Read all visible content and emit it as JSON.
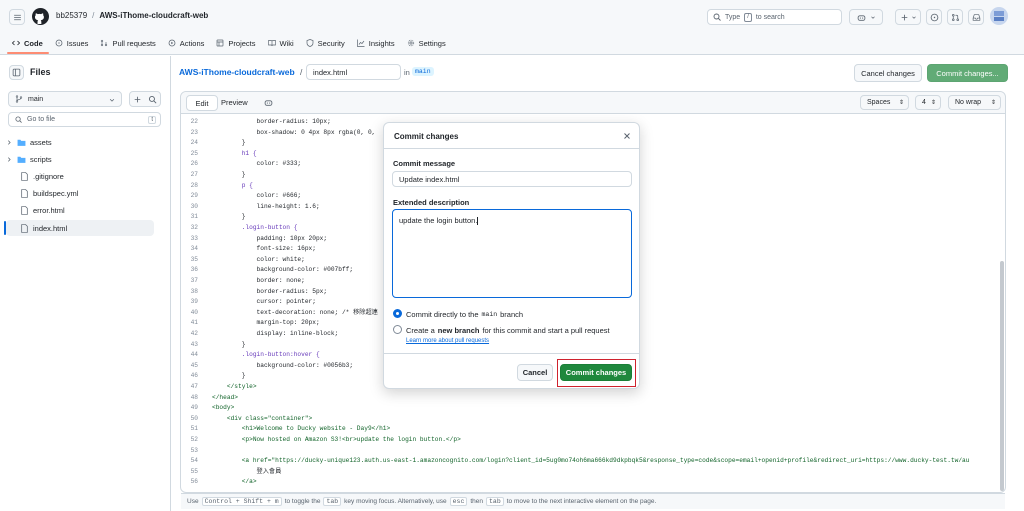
{
  "header": {
    "owner": "bb25379",
    "separator": "/",
    "repo": "AWS-iThome-cloudcraft-web",
    "search_prefix": "Type",
    "search_key": "/",
    "search_suffix": "to search"
  },
  "nav": [
    {
      "label": "Code",
      "icon": "code-icon",
      "active": true
    },
    {
      "label": "Issues",
      "icon": "issue-icon"
    },
    {
      "label": "Pull requests",
      "icon": "pull-request-icon"
    },
    {
      "label": "Actions",
      "icon": "play-icon"
    },
    {
      "label": "Projects",
      "icon": "table-icon"
    },
    {
      "label": "Wiki",
      "icon": "book-icon"
    },
    {
      "label": "Security",
      "icon": "shield-icon"
    },
    {
      "label": "Insights",
      "icon": "graph-icon"
    },
    {
      "label": "Settings",
      "icon": "gear-icon"
    }
  ],
  "sidebar": {
    "title": "Files",
    "branch": "main",
    "goto_placeholder": "Go to file",
    "goto_key": "t",
    "items": [
      {
        "label": "assets",
        "type": "folder"
      },
      {
        "label": "scripts",
        "type": "folder"
      },
      {
        "label": ".gitignore",
        "type": "file"
      },
      {
        "label": "buildspec.yml",
        "type": "file"
      },
      {
        "label": "error.html",
        "type": "file"
      },
      {
        "label": "index.html",
        "type": "file",
        "selected": true
      }
    ]
  },
  "editor": {
    "repo_link": "AWS-iThome-cloudcraft-web",
    "slash": "/",
    "filename": "index.html",
    "in": "in",
    "branch": "main",
    "cancel_label": "Cancel changes",
    "commit_label": "Commit changes...",
    "tab_edit": "Edit",
    "tab_preview": "Preview",
    "indent_mode": "Spaces",
    "indent_size": "4",
    "wrap_mode": "No wrap",
    "footer": {
      "t1": "Use",
      "k1": "Control + Shift + m",
      "t2": "to toggle the",
      "k2": "tab",
      "t3": "key moving focus. Alternatively, use",
      "k3": "esc",
      "t4": "then",
      "k4": "tab",
      "t5": "to move to the next interactive element on the page."
    }
  },
  "code_lines": [
    [
      "22",
      "            border-radius: 10px;"
    ],
    [
      "23",
      "            box-shadow: 0 4px 8px rgba(0, 0,"
    ],
    [
      "24",
      "        }"
    ],
    [
      "25",
      "        h1 {"
    ],
    [
      "26",
      "            color: #333;"
    ],
    [
      "27",
      "        }"
    ],
    [
      "28",
      "        p {"
    ],
    [
      "29",
      "            color: #666;"
    ],
    [
      "30",
      "            line-height: 1.6;"
    ],
    [
      "31",
      "        }"
    ],
    [
      "32",
      "        .login-button {"
    ],
    [
      "33",
      "            padding: 10px 20px;"
    ],
    [
      "34",
      "            font-size: 16px;"
    ],
    [
      "35",
      "            color: white;"
    ],
    [
      "36",
      "            background-color: #007bff;"
    ],
    [
      "37",
      "            border: none;"
    ],
    [
      "38",
      "            border-radius: 5px;"
    ],
    [
      "39",
      "            cursor: pointer;"
    ],
    [
      "40",
      "            text-decoration: none; /* 移除超連"
    ],
    [
      "41",
      "            margin-top: 20px;"
    ],
    [
      "42",
      "            display: inline-block;"
    ],
    [
      "43",
      "        }"
    ],
    [
      "44",
      "        .login-button:hover {"
    ],
    [
      "45",
      "            background-color: #0056b3;"
    ],
    [
      "46",
      "        }"
    ],
    [
      "47",
      "    </style>"
    ],
    [
      "48",
      "</head>"
    ],
    [
      "49",
      "<body>"
    ],
    [
      "50",
      "    <div class=\"container\">"
    ],
    [
      "51",
      "        <h1>Welcome to Ducky website - Day9</h1>"
    ],
    [
      "52",
      "        <p>Now hosted on Amazon S3!<br>update the login button.</p>"
    ],
    [
      "53",
      ""
    ],
    [
      "54",
      "        <a href=\"https://ducky-unique123.auth.us-east-1.amazoncognito.com/login?client_id=5ug0mo74oh6ma666kd9dkpbqk5&response_type=code&scope=email+openid+profile&redirect_uri=https://www.ducky-test.tw/au"
    ],
    [
      "55",
      "            登入會員"
    ],
    [
      "56",
      "        </a>"
    ]
  ],
  "modal": {
    "title": "Commit changes",
    "msg_label": "Commit message",
    "msg_value": "Update index.html",
    "desc_label": "Extended description",
    "desc_value": "update the login button.",
    "opt1_pre": "Commit directly to the",
    "opt1_branch": "main",
    "opt1_post": "branch",
    "opt2_pre": "Create a",
    "opt2_bold": "new branch",
    "opt2_post": "for this commit and start a pull request",
    "learn_more": "Learn more about pull requests",
    "cancel": "Cancel",
    "commit": "Commit changes"
  },
  "colors": {
    "accent": "#1f883d",
    "link": "#0969da",
    "highlight": "#cf222e"
  }
}
